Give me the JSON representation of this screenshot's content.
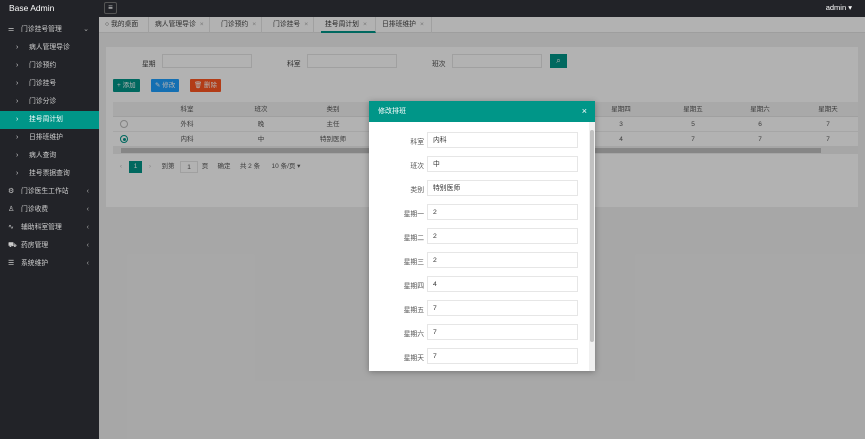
{
  "app": {
    "brand": "Base Admin",
    "user": "admin ▾",
    "menu_icon": "hamburger-icon"
  },
  "sidebar": {
    "items": [
      {
        "label": "门诊挂号管理",
        "icon": "sliders-icon",
        "arrow": "⌄"
      },
      {
        "label": "病人管理导诊",
        "arrow": ""
      },
      {
        "label": "门诊预约",
        "arrow": ""
      },
      {
        "label": "门诊挂号",
        "arrow": ""
      },
      {
        "label": "门诊分诊",
        "arrow": ""
      },
      {
        "label": "挂号周计划",
        "arrow": ""
      },
      {
        "label": "日排班维护",
        "arrow": ""
      },
      {
        "label": "病人查询",
        "arrow": ""
      },
      {
        "label": "挂号票据查询",
        "arrow": ""
      },
      {
        "label": "门诊医生工作站",
        "icon": "gear-icon",
        "arrow": "‹"
      },
      {
        "label": "门诊收费",
        "icon": "user-icon",
        "arrow": "‹"
      },
      {
        "label": "辅助科室管理",
        "icon": "pulse-icon",
        "arrow": "‹"
      },
      {
        "label": "药房管理",
        "icon": "cart-icon",
        "arrow": "‹"
      },
      {
        "label": "系统维护",
        "icon": "database-icon",
        "arrow": "‹"
      }
    ]
  },
  "tabs": [
    {
      "label": "我的桌面",
      "close": ""
    },
    {
      "label": "病人管理导诊",
      "close": "×"
    },
    {
      "label": "门诊预约",
      "close": "×"
    },
    {
      "label": "门诊挂号",
      "close": "×"
    },
    {
      "label": "挂号周计划",
      "close": "×"
    },
    {
      "label": "日排班维护",
      "close": "×"
    }
  ],
  "filters": {
    "weekday_label": "星期",
    "dept_label": "科室",
    "shift_label": "班次",
    "search_icon": "search-icon"
  },
  "toolbar": {
    "add": "+ 添加",
    "edit": "✎ 修改",
    "delete": "🗑 删除"
  },
  "table": {
    "columns": [
      "",
      "科室",
      "班次",
      "类别",
      "星期一",
      "星期二",
      "星期三",
      "星期四",
      "星期五",
      "星期六",
      "星期天"
    ],
    "rows": [
      {
        "selected": false,
        "cells": [
          "外科",
          "晚",
          "主任",
          "",
          "",
          "",
          "3",
          "5",
          "6",
          "7"
        ]
      },
      {
        "selected": true,
        "cells": [
          "内科",
          "中",
          "特别医师",
          "",
          "",
          "",
          "4",
          "7",
          "7",
          "7"
        ]
      }
    ]
  },
  "pager": {
    "prev": "‹",
    "current": "1",
    "next": "›",
    "goto": "到第",
    "page": "1",
    "page_unit": "页",
    "confirm": "确定",
    "total": "共 2 条",
    "size": "10 条/页 ▾"
  },
  "dialog": {
    "title": "修改排班",
    "close": "×",
    "fields": [
      {
        "label": "科室",
        "value": "内科"
      },
      {
        "label": "班次",
        "value": "中"
      },
      {
        "label": "类别",
        "value": "特别医师"
      },
      {
        "label": "星期一",
        "value": "2"
      },
      {
        "label": "星期二",
        "value": "2"
      },
      {
        "label": "星期三",
        "value": "2"
      },
      {
        "label": "星期四",
        "value": "4"
      },
      {
        "label": "星期五",
        "value": "7"
      },
      {
        "label": "星期六",
        "value": "7"
      },
      {
        "label": "星期天",
        "value": "7"
      }
    ]
  },
  "colors": {
    "primary": "#009688",
    "blue": "#1e9fff",
    "danger": "#ff5722",
    "dark": "#222328"
  }
}
